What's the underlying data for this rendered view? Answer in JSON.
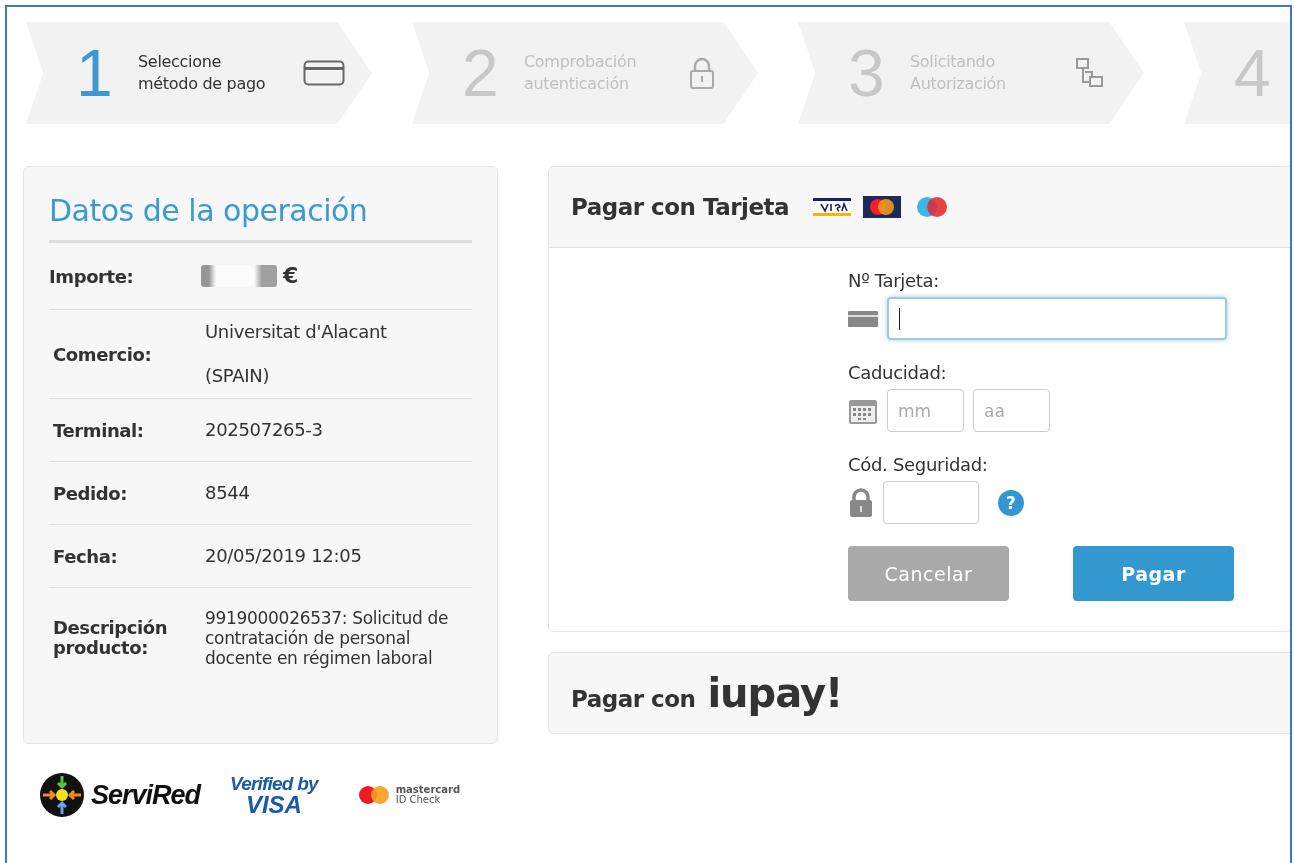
{
  "steps": [
    {
      "number": "1",
      "label_lines": [
        "Seleccione",
        "método de pago"
      ],
      "selected": true,
      "kind": "card"
    },
    {
      "number": "2",
      "label_lines": [
        "Comprobación",
        "autenticación"
      ],
      "selected": false,
      "kind": "lock"
    },
    {
      "number": "3",
      "label_lines": [
        "Solicitando",
        "Autorización"
      ],
      "selected": false,
      "kind": "network"
    },
    {
      "number": "4",
      "selected": false
    }
  ],
  "operation": {
    "title": "Datos de la operación",
    "rows": [
      {
        "kind": "amount",
        "label": "Importe:",
        "value": "€"
      },
      {
        "kind": "text",
        "label": "Comercio:",
        "value": "Universitat d'Alacant (SPAIN)"
      },
      {
        "kind": "text",
        "label": "Terminal:",
        "value": "202507265-3"
      },
      {
        "kind": "text",
        "label": "Pedido:",
        "value": "8544"
      },
      {
        "kind": "text",
        "label": "Fecha:",
        "value": "20/05/2019  12:05"
      },
      {
        "kind": "long",
        "label": "Descripción producto:",
        "value": "9919000026537: Solicitud de contratación de personal docente en régimen laboral"
      }
    ]
  },
  "footer_logos": [
    {
      "kind": "servired",
      "lines": [
        "ServiRed"
      ]
    },
    {
      "kind": "visa",
      "lines": [
        "Verified by",
        "VISA"
      ]
    },
    {
      "kind": "mastercard",
      "lines": [
        "mastercard",
        "ID Check"
      ]
    }
  ],
  "card_payment": {
    "title": "Pagar con Tarjeta",
    "card_number": {
      "label": "Nº Tarjeta:",
      "focused": true
    },
    "expiry": {
      "label": "Caducidad:",
      "month_placeholder": "mm",
      "year_placeholder": "aa"
    },
    "security_code": {
      "label": "Cód. Seguridad:",
      "help": "?"
    },
    "buttons": [
      {
        "kind": "cancel",
        "label": "Cancelar",
        "disabled": true
      },
      {
        "kind": "pay",
        "label": "Pagar",
        "disabled": false
      }
    ]
  },
  "iupay": {
    "title": "Pagar con",
    "logo": "iupay!"
  }
}
